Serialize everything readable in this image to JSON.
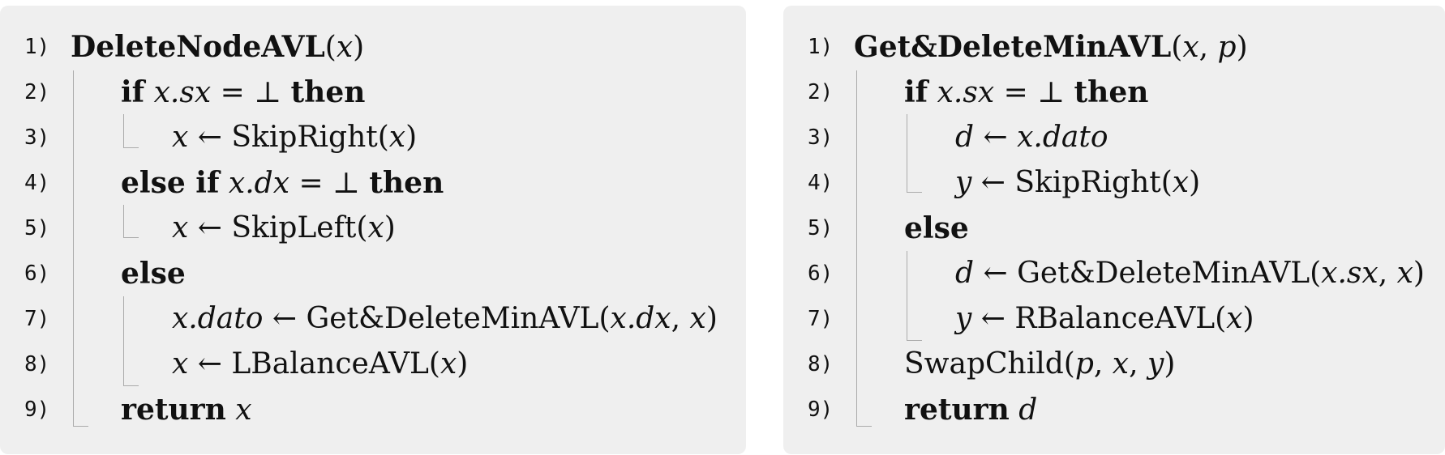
{
  "left": {
    "lines": [
      {
        "n": "1)",
        "parts": [
          {
            "t": "DeleteNodeAVL",
            "c": "fn-b"
          },
          {
            "t": "(",
            "c": ""
          },
          {
            "t": "x",
            "c": "v"
          },
          {
            "t": ")",
            "c": ""
          }
        ]
      },
      {
        "n": "2)",
        "parts": [
          {
            "t": "if",
            "c": "kw"
          },
          {
            "t": " ",
            "c": ""
          },
          {
            "t": "x.sx",
            "c": "v"
          },
          {
            "t": " = ⊥ ",
            "c": ""
          },
          {
            "t": "then",
            "c": "kw"
          }
        ]
      },
      {
        "n": "3)",
        "parts": [
          {
            "t": "x",
            "c": "v"
          },
          {
            "t": " ← SkipRight(",
            "c": ""
          },
          {
            "t": "x",
            "c": "v"
          },
          {
            "t": ")",
            "c": ""
          }
        ]
      },
      {
        "n": "4)",
        "parts": [
          {
            "t": "else if",
            "c": "kw"
          },
          {
            "t": " ",
            "c": ""
          },
          {
            "t": "x.dx",
            "c": "v"
          },
          {
            "t": " = ⊥ ",
            "c": ""
          },
          {
            "t": "then",
            "c": "kw"
          }
        ]
      },
      {
        "n": "5)",
        "parts": [
          {
            "t": "x",
            "c": "v"
          },
          {
            "t": " ← SkipLeft(",
            "c": ""
          },
          {
            "t": "x",
            "c": "v"
          },
          {
            "t": ")",
            "c": ""
          }
        ]
      },
      {
        "n": "6)",
        "parts": [
          {
            "t": "else",
            "c": "kw"
          }
        ]
      },
      {
        "n": "7)",
        "parts": [
          {
            "t": "x.dato",
            "c": "v"
          },
          {
            "t": " ← Get&DeleteMinAVL(",
            "c": ""
          },
          {
            "t": "x.dx",
            "c": "v"
          },
          {
            "t": ", ",
            "c": ""
          },
          {
            "t": "x",
            "c": "v"
          },
          {
            "t": ")",
            "c": ""
          }
        ]
      },
      {
        "n": "8)",
        "parts": [
          {
            "t": "x",
            "c": "v"
          },
          {
            "t": " ← LBalanceAVL(",
            "c": ""
          },
          {
            "t": "x",
            "c": "v"
          },
          {
            "t": ")",
            "c": ""
          }
        ]
      },
      {
        "n": "9)",
        "parts": [
          {
            "t": "return",
            "c": "kw"
          },
          {
            "t": " ",
            "c": ""
          },
          {
            "t": "x",
            "c": "v"
          }
        ]
      }
    ]
  },
  "right": {
    "lines": [
      {
        "n": "1)",
        "parts": [
          {
            "t": "Get&DeleteMinAVL",
            "c": "fn-b"
          },
          {
            "t": "(",
            "c": ""
          },
          {
            "t": "x",
            "c": "v"
          },
          {
            "t": ", ",
            "c": ""
          },
          {
            "t": "p",
            "c": "v"
          },
          {
            "t": ")",
            "c": ""
          }
        ]
      },
      {
        "n": "2)",
        "parts": [
          {
            "t": "if",
            "c": "kw"
          },
          {
            "t": " ",
            "c": ""
          },
          {
            "t": "x.sx",
            "c": "v"
          },
          {
            "t": " = ⊥ ",
            "c": ""
          },
          {
            "t": "then",
            "c": "kw"
          }
        ]
      },
      {
        "n": "3)",
        "parts": [
          {
            "t": "d",
            "c": "v"
          },
          {
            "t": " ← ",
            "c": ""
          },
          {
            "t": "x.dato",
            "c": "v"
          }
        ]
      },
      {
        "n": "4)",
        "parts": [
          {
            "t": "y",
            "c": "v"
          },
          {
            "t": " ← SkipRight(",
            "c": ""
          },
          {
            "t": "x",
            "c": "v"
          },
          {
            "t": ")",
            "c": ""
          }
        ]
      },
      {
        "n": "5)",
        "parts": [
          {
            "t": "else",
            "c": "kw"
          }
        ]
      },
      {
        "n": "6)",
        "parts": [
          {
            "t": "d",
            "c": "v"
          },
          {
            "t": " ← Get&DeleteMinAVL(",
            "c": ""
          },
          {
            "t": "x.sx",
            "c": "v"
          },
          {
            "t": ", ",
            "c": ""
          },
          {
            "t": "x",
            "c": "v"
          },
          {
            "t": ")",
            "c": ""
          }
        ]
      },
      {
        "n": "7)",
        "parts": [
          {
            "t": "y",
            "c": "v"
          },
          {
            "t": " ← RBalanceAVL(",
            "c": ""
          },
          {
            "t": "x",
            "c": "v"
          },
          {
            "t": ")",
            "c": ""
          }
        ]
      },
      {
        "n": "8)",
        "parts": [
          {
            "t": "SwapChild(",
            "c": ""
          },
          {
            "t": "p",
            "c": "v"
          },
          {
            "t": ", ",
            "c": ""
          },
          {
            "t": "x",
            "c": "v"
          },
          {
            "t": ", ",
            "c": ""
          },
          {
            "t": "y",
            "c": "v"
          },
          {
            "t": ")",
            "c": ""
          }
        ]
      },
      {
        "n": "9)",
        "parts": [
          {
            "t": "return",
            "c": "kw"
          },
          {
            "t": " ",
            "c": ""
          },
          {
            "t": "d",
            "c": "v"
          }
        ]
      }
    ]
  }
}
